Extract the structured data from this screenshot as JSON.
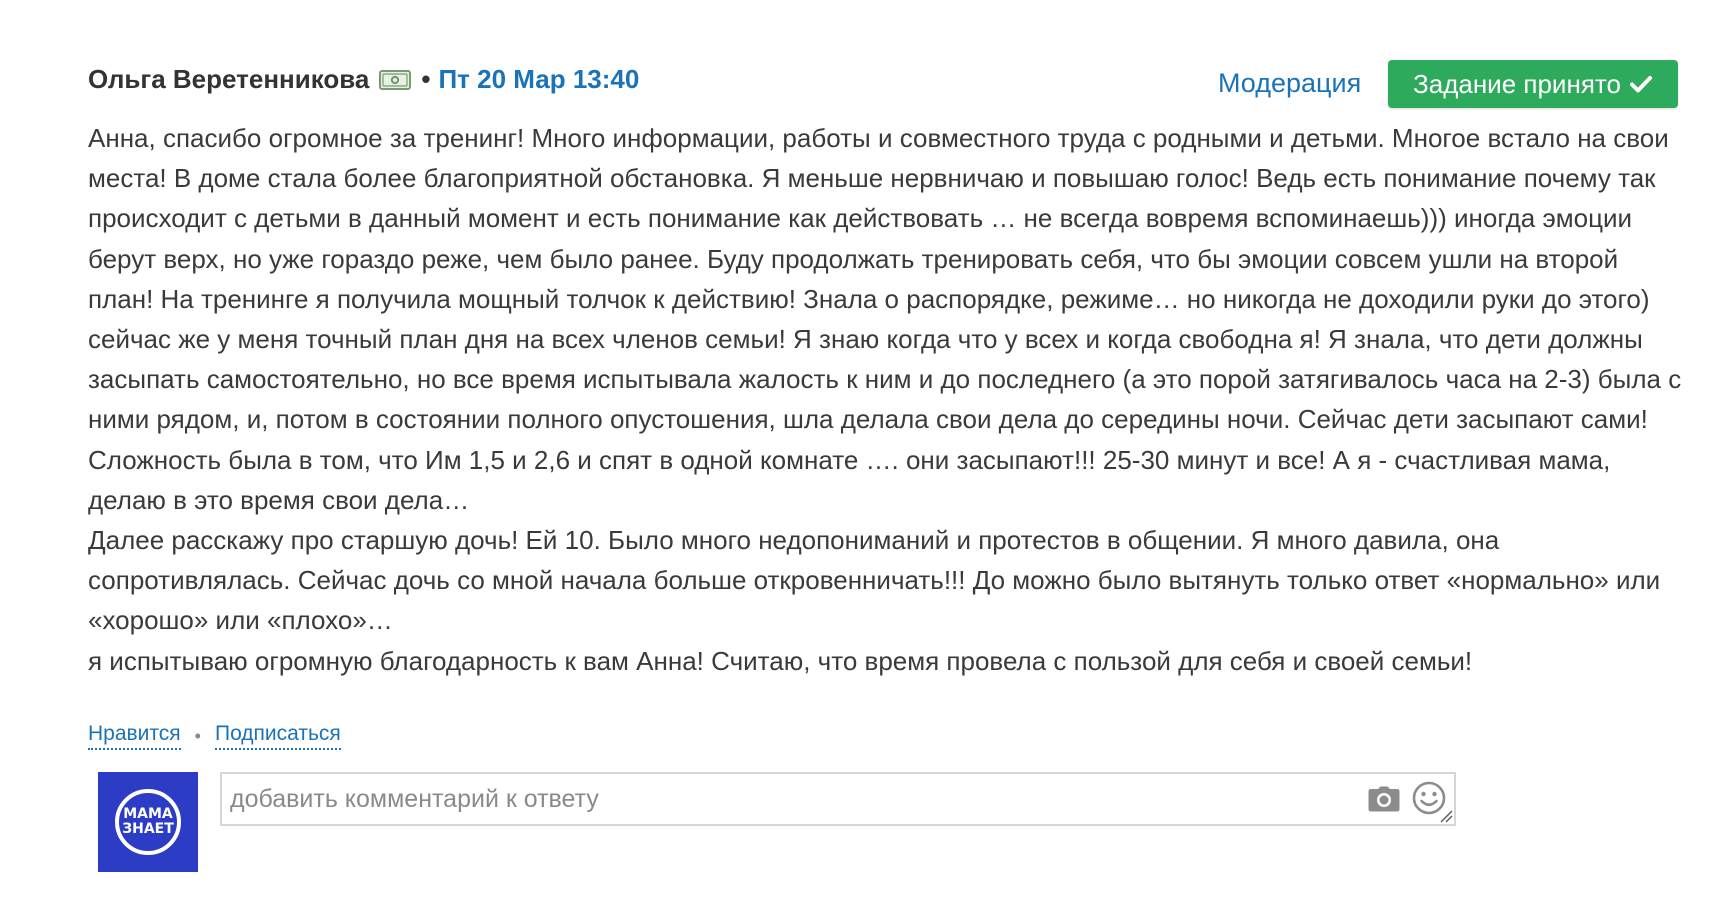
{
  "post": {
    "author": "Ольга Веретенникова",
    "separator": "•",
    "date": "Пт 20 Мар 13:40",
    "moderation_label": "Модерация",
    "accepted_label": "Задание принято",
    "body": [
      "Анна, спасибо огромное за тренинг! Много информации, работы и совместного труда с родными и детьми. Многое встало на свои места! В доме стала более благоприятной обстановка. Я меньше нервничаю и повышаю голос! Ведь есть понимание почему так происходит с детьми в данный момент и есть понимание как действовать … не всегда вовремя вспоминаешь))) иногда эмоции берут верх, но уже гораздо реже, чем было ранее. Буду продолжать тренировать себя, что бы эмоции совсем ушли на второй план! На тренинге я получила мощный толчок к действию! Знала о распорядке, режиме… но никогда не доходили руки до этого) сейчас же у меня точный план дня на всех членов семьи! Я знаю когда что у всех и когда свободна я! Я знала, что дети должны засыпать самостоятельно, но все время испытывала жалость к ним и до последнего (а это порой затягивалось часа на 2-3) была с ними рядом, и, потом в состоянии полного опустошения, шла делала свои дела до середины ночи. Сейчас дети засыпают сами! Сложность была в том, что Им 1,5 и 2,6 и спят в одной комнате …. они засыпают!!! 25-30 минут и все! А я - счастливая мама, делаю в это время свои дела…",
      "Далее расскажу про старшую дочь! Ей 10. Было много недопониманий и протестов в общении. Я много давила, она сопротивлялась. Сейчас дочь со мной начала больше откровенничать!!! До можно было вытянуть только ответ «нормально» или «хорошо» или «плохо»…",
      "я испытываю огромную благодарность к вам Анна! Считаю, что время провела с пользой для себя и своей семьи!"
    ]
  },
  "actions": {
    "like_label": "Нравится",
    "dot": "•",
    "subscribe_label": "Подписаться"
  },
  "comment": {
    "placeholder": "добавить комментарий к ответу",
    "avatar_line1": "МАМА",
    "avatar_line2": "ЗНАЕТ"
  },
  "icons": {
    "money": "money-bill-icon",
    "check": "check-icon",
    "camera": "camera-icon",
    "smile": "smile-icon",
    "resize": "resize-handle-icon"
  },
  "colors": {
    "link": "#1a73b8",
    "accepted_button": "#2eaa5c",
    "avatar_bg": "#2c3cc4",
    "text": "#3a3a3a"
  }
}
